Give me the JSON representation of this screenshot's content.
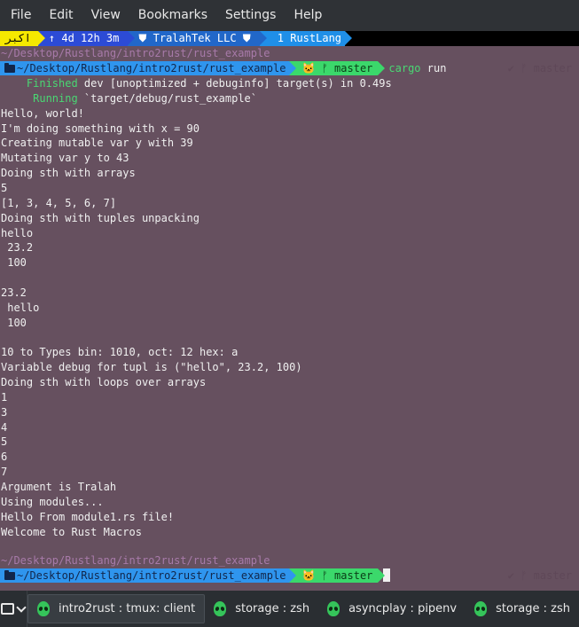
{
  "menu": [
    "File",
    "Edit",
    "View",
    "Bookmarks",
    "Settings",
    "Help"
  ],
  "tmux": {
    "layout": "اکبر",
    "uptime": "↑ 4d 12h 3m",
    "host": "TralahTek LLC",
    "window": "1 RustLang"
  },
  "prompt": {
    "short_path": "~/Desktop/Rustlang/intro2rust/rust_example",
    "path": "~/Desktop/Rustlang/intro2rust/rust_example",
    "branch_icon": "🐱",
    "branch": "master",
    "command": "cargo",
    "command_arg": "run",
    "right_status": "✔ ᚠ master"
  },
  "output": [
    "    Finished dev [unoptimized + debuginfo] target(s) in 0.49s",
    "     Running `target/debug/rust_example`",
    "Hello, world!",
    "I'm doing something with x = 90",
    "Creating mutable var y with 39",
    "Mutating var y to 43",
    "Doing sth with arrays",
    "5",
    "[1, 3, 4, 5, 6, 7]",
    "Doing sth with tuples unpacking",
    "hello",
    " 23.2",
    " 100",
    "",
    "23.2",
    " hello",
    " 100",
    "",
    "10 to Types bin: 1010, oct: 12 hex: a",
    "Variable debug for tupl is (\"hello\", 23.2, 100)",
    "Doing sth with loops over arrays",
    "1",
    "3",
    "4",
    "5",
    "6",
    "7",
    "Argument is Tralah",
    "Using modules...",
    "Hello From module1.rs file!",
    "Welcome to Rust Macros"
  ],
  "taskbar": [
    {
      "label": "intro2rust : tmux: client",
      "icon": "alien-icon"
    },
    {
      "label": "storage : zsh",
      "icon": "alien-icon"
    },
    {
      "label": "asyncplay : pipenv",
      "icon": "alien-icon"
    },
    {
      "label": "storage : zsh",
      "icon": "alien-icon"
    }
  ]
}
